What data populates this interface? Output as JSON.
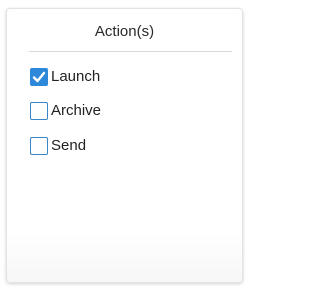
{
  "panel": {
    "title": "Action(s)",
    "options": [
      {
        "label": "Launch",
        "checked": true
      },
      {
        "label": "Archive",
        "checked": false
      },
      {
        "label": "Send",
        "checked": false
      }
    ]
  },
  "colors": {
    "checkbox_accent": "#2e88d9",
    "checkbox_border": "#3a86c8"
  },
  "icons": {
    "check": "checkmark-icon"
  }
}
